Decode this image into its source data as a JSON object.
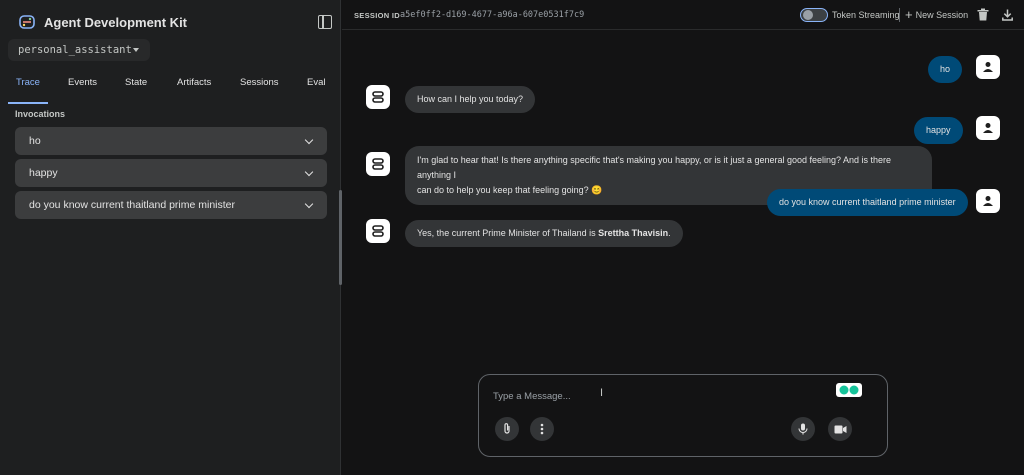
{
  "app": {
    "title": "Agent Development Kit"
  },
  "agent_selector": {
    "value": "personal_assistant"
  },
  "tabs": [
    {
      "label": "Trace",
      "active": true
    },
    {
      "label": "Events",
      "active": false
    },
    {
      "label": "State",
      "active": false
    },
    {
      "label": "Artifacts",
      "active": false
    },
    {
      "label": "Sessions",
      "active": false
    },
    {
      "label": "Eval",
      "active": false
    }
  ],
  "invocations": {
    "title": "Invocations",
    "items": [
      {
        "label": "ho"
      },
      {
        "label": "happy"
      },
      {
        "label": "do you know current thaitland prime minister"
      }
    ]
  },
  "header": {
    "session_label": "SESSION ID",
    "session_id": "a5ef0ff2-d169-4677-a96a-607e0531f7c9",
    "token_streaming_label": "Token Streaming",
    "token_streaming_on": false,
    "new_session_label": "New Session",
    "icons": [
      "sidebar-collapse-icon",
      "delete-icon",
      "download-icon"
    ]
  },
  "messages": [
    {
      "role": "user",
      "text": "ho"
    },
    {
      "role": "bot",
      "text": "How can I help you today?"
    },
    {
      "role": "user",
      "text": "happy"
    },
    {
      "role": "bot",
      "line1": "I'm glad to hear that! Is there anything specific that's making you happy, or is it just a general good feeling? And is there anything I",
      "line2": "can do to help you keep that feeling going?",
      "emoji": "😊"
    },
    {
      "role": "user",
      "text": "do you know current thaitland prime minister"
    },
    {
      "role": "bot",
      "prefix": "Yes, the current Prime Minister of Thailand is ",
      "bold": "Srettha Thavisin",
      "suffix": "."
    }
  ],
  "composer": {
    "placeholder": "Type a Message...",
    "icons": [
      "attach-icon",
      "more-vert-icon",
      "mic-icon",
      "videocam-icon"
    ]
  },
  "colors": {
    "accent": "#8ab4f8",
    "user_bubble": "#004a77",
    "bot_bubble": "#333537",
    "background": "#131314",
    "sidebar": "#1e1f20"
  }
}
